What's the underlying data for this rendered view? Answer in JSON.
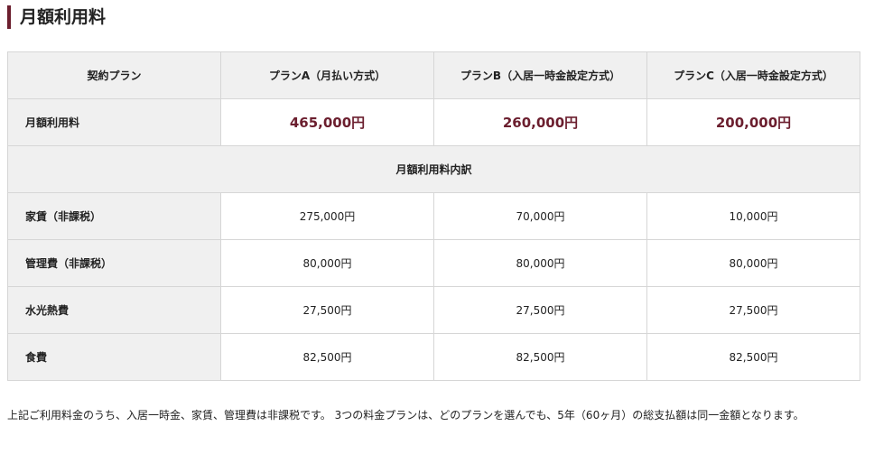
{
  "title": "月額利用料",
  "table": {
    "header": [
      "契約プラン",
      "プランA（月払い方式）",
      "プランB（入居一時金設定方式）",
      "プランC（入居一時金設定方式）"
    ],
    "total": {
      "label": "月額利用料",
      "values": [
        "465,000円",
        "260,000円",
        "200,000円"
      ]
    },
    "section": "月額利用料内訳",
    "rows": [
      {
        "label": "家賃（非課税）",
        "values": [
          "275,000円",
          "70,000円",
          "10,000円"
        ]
      },
      {
        "label": "管理費（非課税）",
        "values": [
          "80,000円",
          "80,000円",
          "80,000円"
        ]
      },
      {
        "label": "水光熱費",
        "values": [
          "27,500円",
          "27,500円",
          "27,500円"
        ]
      },
      {
        "label": "食費",
        "values": [
          "82,500円",
          "82,500円",
          "82,500円"
        ]
      }
    ]
  },
  "note": "上記ご利用料金のうち、入居一時金、家賃、管理費は非課税です。 3つの料金プランは、どのプランを選んでも、5年（60ヶ月）の総支払額は同一金額となります。",
  "colors": {
    "accent": "#6b1e2e",
    "header_bg": "#f0f0f0",
    "border": "#d6d6d6"
  },
  "chart_data": {
    "type": "table",
    "columns": [
      "契約プラン",
      "プランA（月払い方式）",
      "プランB（入居一時金設定方式）",
      "プランC（入居一時金設定方式）"
    ],
    "rows": [
      [
        "月額利用料",
        "465,000円",
        "260,000円",
        "200,000円"
      ],
      [
        "家賃（非課税）",
        "275,000円",
        "70,000円",
        "10,000円"
      ],
      [
        "管理費（非課税）",
        "80,000円",
        "80,000円",
        "80,000円"
      ],
      [
        "水光熱費",
        "27,500円",
        "27,500円",
        "27,500円"
      ],
      [
        "食費",
        "82,500円",
        "82,500円",
        "82,500円"
      ]
    ]
  }
}
